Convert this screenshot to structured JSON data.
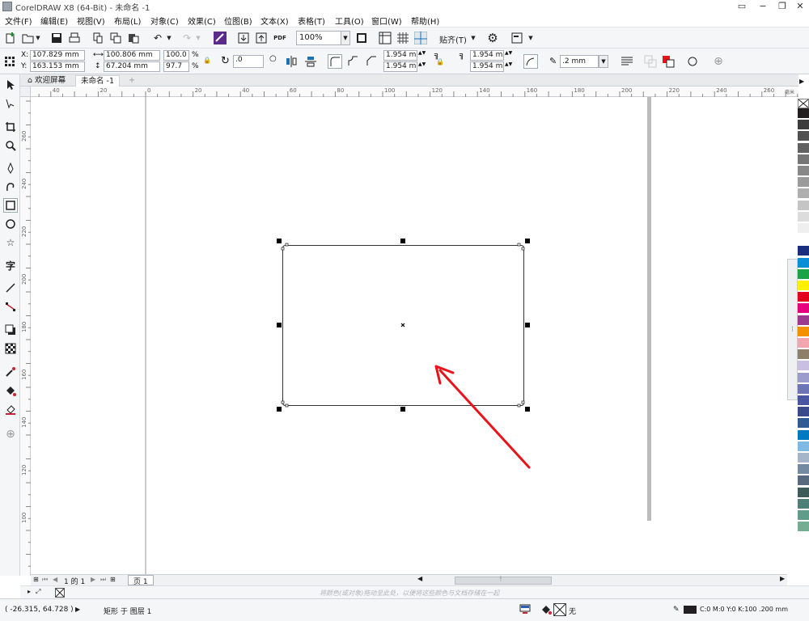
{
  "window": {
    "title": "CorelDRAW X8 (64-Bit) - 未命名 -1",
    "controls": [
      "▭",
      "−",
      "❐",
      "✕"
    ]
  },
  "menu": [
    "文件(F)",
    "编辑(E)",
    "视图(V)",
    "布局(L)",
    "对象(C)",
    "效果(C)",
    "位图(B)",
    "文本(X)",
    "表格(T)",
    "工具(O)",
    "窗口(W)",
    "帮助(H)"
  ],
  "toolbar": {
    "pdf_label": "PDF",
    "zoom_value": "100%",
    "snap_label": "贴齐(T)"
  },
  "property_bar": {
    "x_label": "X:",
    "x_value": "107.829 mm",
    "y_label": "Y:",
    "y_value": "163.153 mm",
    "width_value": "100.806 mm",
    "height_value": "67.204 mm",
    "scale_w": "100.0",
    "scale_h": "97.7",
    "percent": "%",
    "rotation_value": ".0",
    "corner_tl": "1.954 mm",
    "corner_bl": "1.954 mm",
    "corner_tr": "1.954 mm",
    "corner_br": "1.954 mm",
    "outline_width": ".2 mm"
  },
  "tabs": [
    {
      "label": "欢迎屏幕",
      "active": false
    },
    {
      "label": "未命名 -1",
      "active": true
    }
  ],
  "ruler_h_labels": [
    "40",
    "20",
    "0",
    "20",
    "40",
    "60",
    "80",
    "100",
    "120",
    "140",
    "160",
    "180",
    "200",
    "220",
    "240",
    "260"
  ],
  "ruler_v_labels": [
    "260",
    "240",
    "220",
    "200",
    "180",
    "160",
    "140",
    "120",
    "100"
  ],
  "ruler_unit": "毫米",
  "page_nav": {
    "position": "1 的 1",
    "page_tab": "页 1"
  },
  "hint_text": "将颜色(或对象)拖动至此处，以便将这些颜色与文档存储在一起",
  "status": {
    "coords": "( -26.315, 64.728 )",
    "object_info": "矩形 于 图层 1",
    "fill_none": "无",
    "outline_info": "C:0 M:0 Y:0 K:100 .200 mm"
  },
  "palette_colors": [
    "#231f20",
    "#3c3c3c",
    "#515151",
    "#626262",
    "#767676",
    "#888888",
    "#9b9b9b",
    "#afafaf",
    "#c5c5c5",
    "#dcdcdc",
    "#efefef",
    "#ffffff",
    "#1b2f7f",
    "#0a8fd6",
    "#1ba345",
    "#ffef00",
    "#e2001a",
    "#e6007e",
    "#9a3b8e",
    "#f39200",
    "#f4a6b0",
    "#8f7f6a",
    "#c9bfe3",
    "#9c9ccc",
    "#6c74b7",
    "#4a56a3",
    "#3a4a8c",
    "#2f5c94",
    "#0079c1",
    "#7fb9e4",
    "#a5b6c8",
    "#738aa0",
    "#56697d",
    "#3d5b59",
    "#4e8078",
    "#5f9d8a",
    "#75ad93"
  ],
  "colors": {
    "arrow": "#e8141b",
    "page_shadow": "#bcbcbc"
  }
}
